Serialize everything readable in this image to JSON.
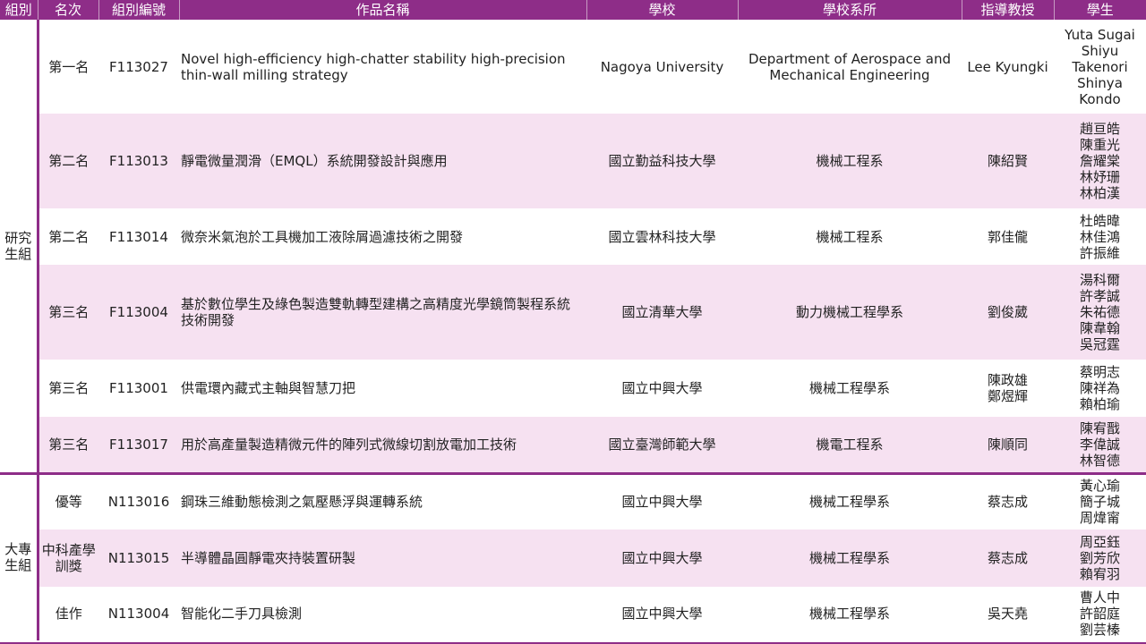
{
  "headers": [
    "組別",
    "名次",
    "組別編號",
    "作品名稱",
    "學校",
    "學校系所",
    "指導教授",
    "學生"
  ],
  "groups": [
    {
      "name": "研究\n生組",
      "rows": [
        {
          "rank": "第一名",
          "id": "F113027",
          "title": "Novel high-efficiency high-chatter stability high-precision thin-wall milling strategy",
          "school": "Nagoya University",
          "dept": "Department of Aerospace and Mechanical Engineering",
          "advisor": "Lee Kyungki",
          "students": "Yuta Sugai\nShiyu\nTakenori\nShinya\nKondo"
        },
        {
          "rank": "第二名",
          "id": "F113013",
          "title": "靜電微量潤滑（EMQL）系統開發設計與應用",
          "school": "國立勤益科技大學",
          "dept": "機械工程系",
          "advisor": "陳紹賢",
          "students": "趙亘皓\n陳重光\n詹耀棠\n林妤珊\n林柏漢"
        },
        {
          "rank": "第二名",
          "id": "F113014",
          "title": "微奈米氣泡於工具機加工液除屑過濾技術之開發",
          "school": "國立雲林科技大學",
          "dept": "機械工程系",
          "advisor": "郭佳儱",
          "students": "杜皓暐\n林佳鴻\n許振維"
        },
        {
          "rank": "第三名",
          "id": "F113004",
          "title": "基於數位學生及綠色製造雙軌轉型建構之高精度光學鏡筒製程系統技術開發",
          "school": "國立清華大學",
          "dept": "動力機械工程學系",
          "advisor": "劉俊葳",
          "students": "湯科爾\n許孝誠\n朱祐德\n陳韋翰\n吳冠霆"
        },
        {
          "rank": "第三名",
          "id": "F113001",
          "title": "供電環內藏式主軸與智慧刀把",
          "school": "國立中興大學",
          "dept": "機械工程學系",
          "advisor": "陳政雄\n鄭煜輝",
          "students": "蔡明志\n陳祥為\n賴柏瑜"
        },
        {
          "rank": "第三名",
          "id": "F113017",
          "title": "用於高產量製造精微元件的陣列式微線切割放電加工技術",
          "school": "國立臺灣師範大學",
          "dept": "機電工程系",
          "advisor": "陳順同",
          "students": "陳宥戬\n李偉誠\n林智德"
        }
      ]
    },
    {
      "name": "大專\n生組",
      "rows": [
        {
          "rank": "優等",
          "id": "N113016",
          "title": "鋼珠三維動態檢測之氣壓懸浮與運轉系統",
          "school": "國立中興大學",
          "dept": "機械工程學系",
          "advisor": "蔡志成",
          "students": "黃心瑜\n簡子城\n周煒甯"
        },
        {
          "rank": "中科產學\n訓獎",
          "id": "N113015",
          "title": "半導體晶圓靜電夾持裝置研製",
          "school": "國立中興大學",
          "dept": "機械工程學系",
          "advisor": "蔡志成",
          "students": "周亞鈺\n劉芳欣\n賴宥羽"
        },
        {
          "rank": "佳作",
          "id": "N113004",
          "title": "智能化二手刀具檢測",
          "school": "國立中興大學",
          "dept": "機械工程學系",
          "advisor": "吳天堯",
          "students": "曹人中\n許韶庭\n劉芸榛"
        }
      ]
    }
  ]
}
